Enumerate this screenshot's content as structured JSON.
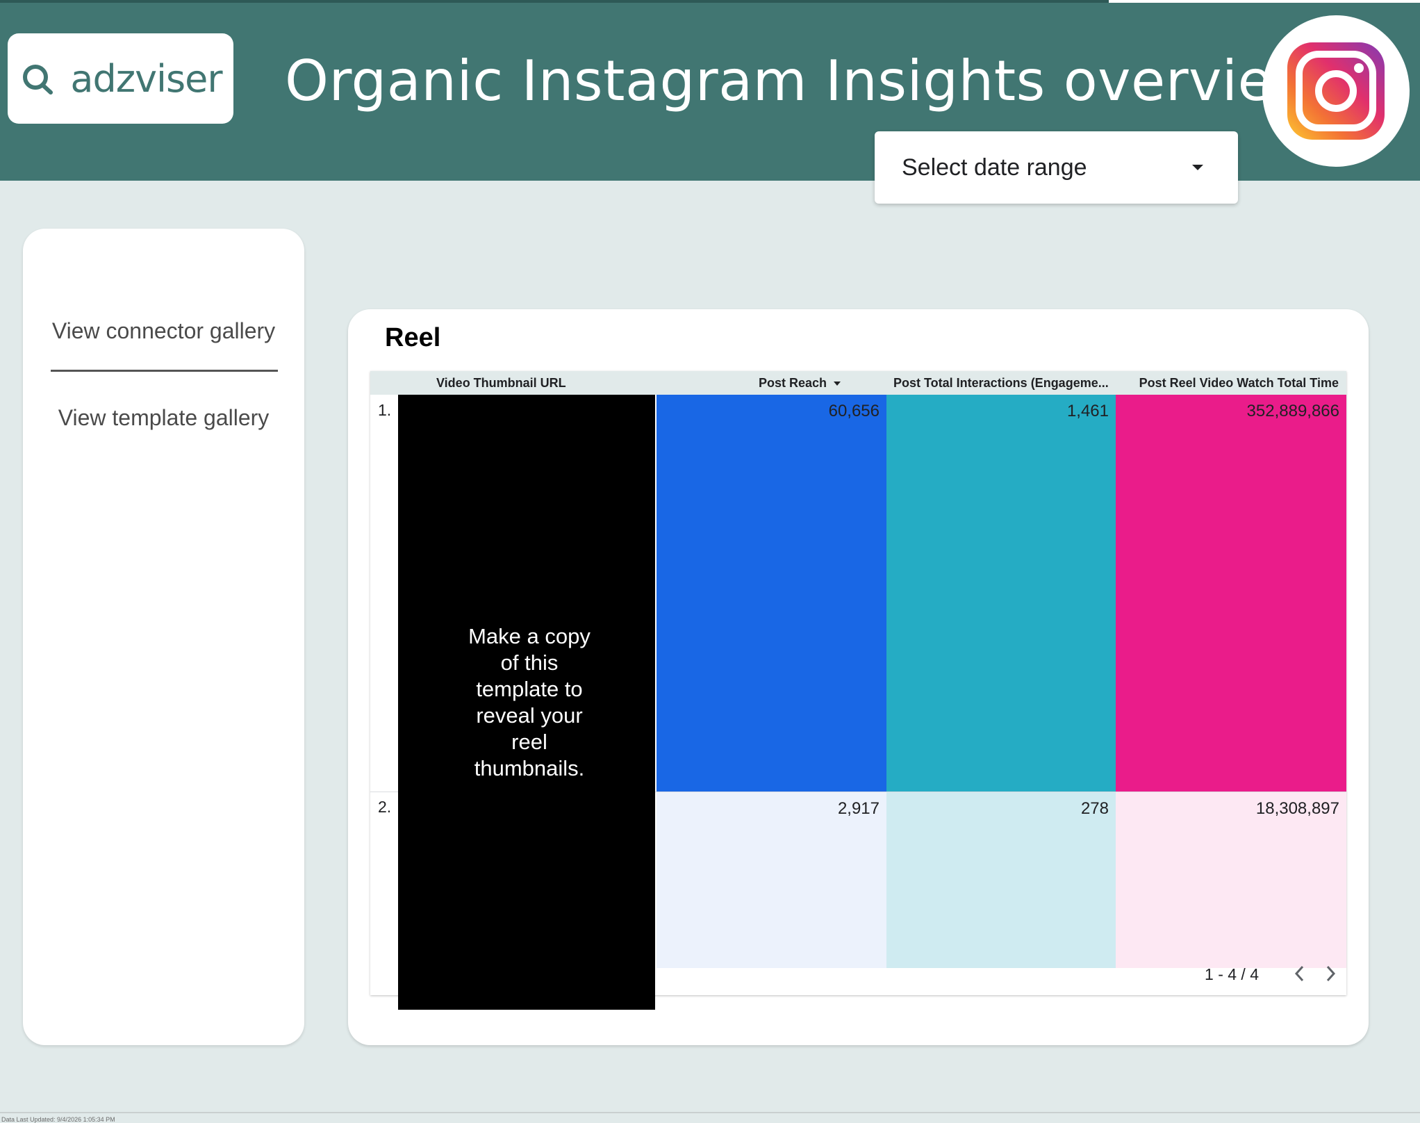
{
  "header": {
    "brand": "adzviser",
    "title": "Organic Instagram Insights overview",
    "date_range_label": "Select date range"
  },
  "sidebar": {
    "links": [
      {
        "label": "View connector gallery"
      },
      {
        "label": "View template gallery"
      }
    ]
  },
  "reel": {
    "title": "Reel",
    "columns": {
      "thumbnail": "Video Thumbnail URL",
      "reach": "Post Reach",
      "interactions": "Post Total Interactions (Engageme...",
      "watch_time": "Post Reel Video Watch Total Time"
    },
    "thumbnail_message": "Make a copy of this template to reveal your reel thumbnails.",
    "rows": [
      {
        "num": "1.",
        "reach": "60,656",
        "interactions": "1,461",
        "watch_time": "352,889,866"
      },
      {
        "num": "2.",
        "reach": "2,917",
        "interactions": "278",
        "watch_time": "18,308,897"
      }
    ],
    "pagination": "1 - 4 / 4",
    "colors": {
      "reach": "#1967e5",
      "interactions": "#25acc4",
      "watch_time": "#ea1c8a",
      "reach_light": "#ecf2fc",
      "interactions_light": "#cfebf1",
      "watch_time_light": "#fde8f3"
    }
  },
  "footer": {
    "text": "Data Last Updated: 9/4/2026 1:05:34 PM"
  },
  "theme": {
    "header_bg": "#417672",
    "page_bg": "#e1eaea"
  }
}
